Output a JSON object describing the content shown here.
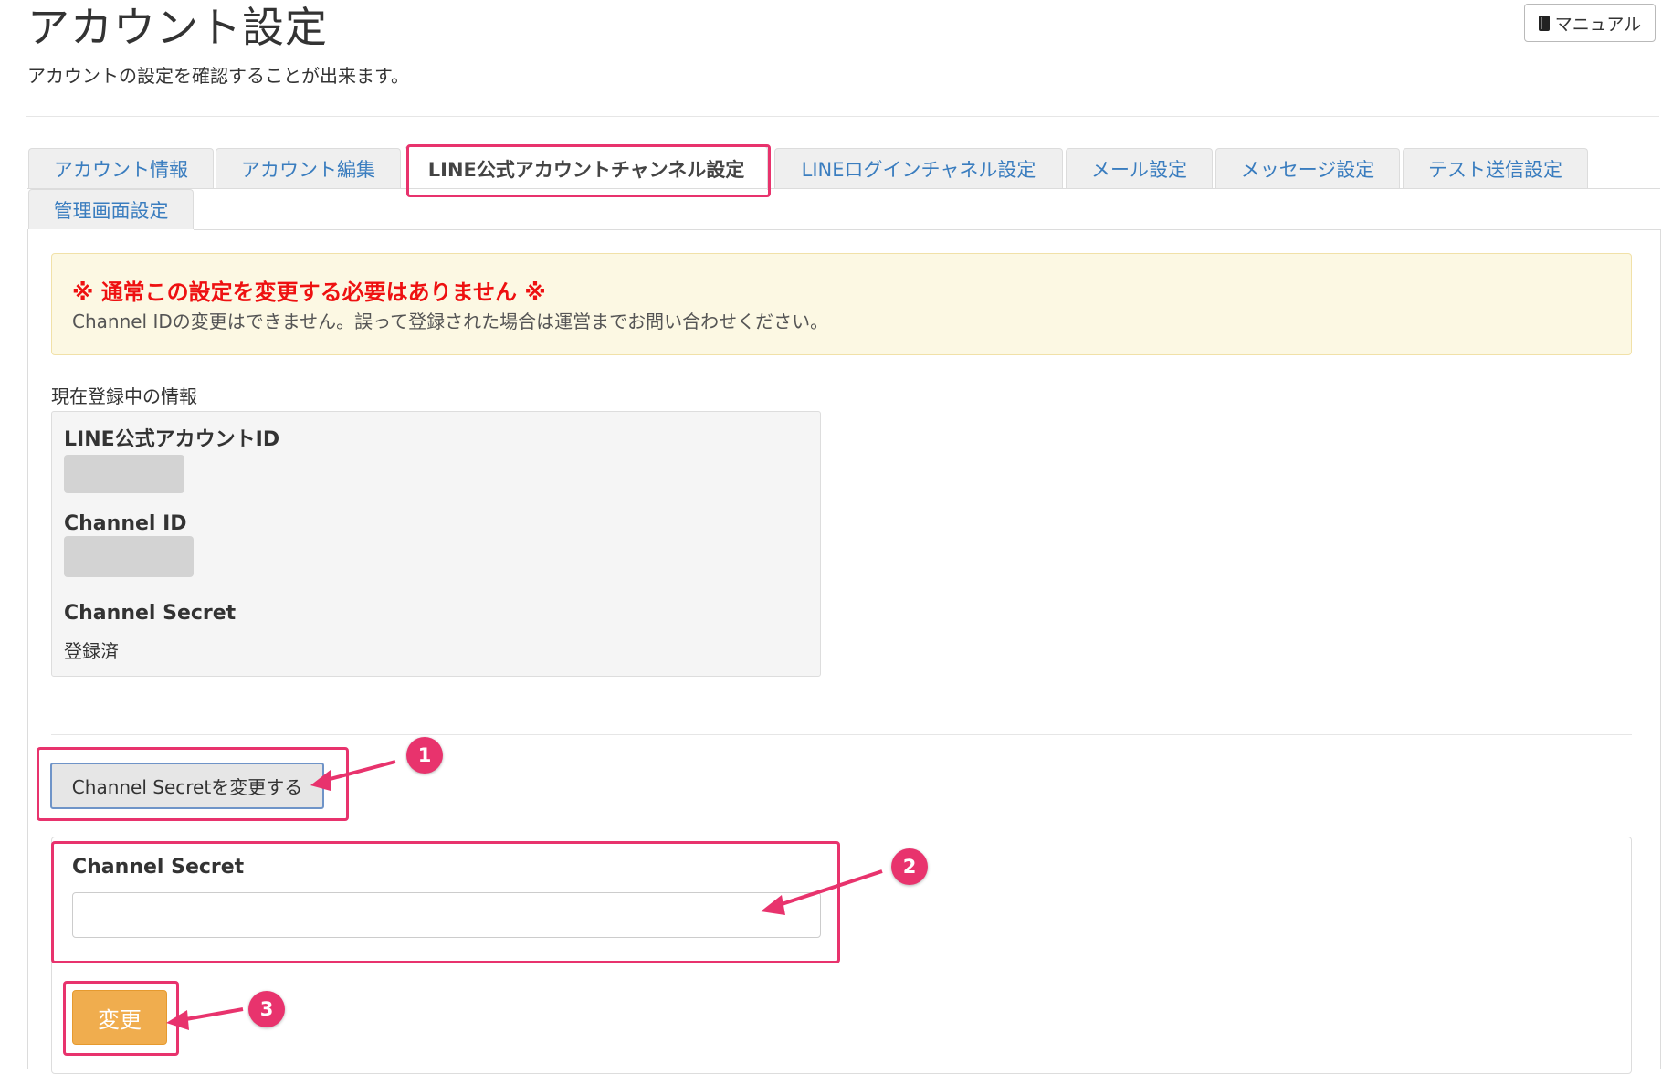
{
  "header": {
    "title": "アカウント設定",
    "subtitle": "アカウントの設定を確認することが出来ます。",
    "manual_button": {
      "label": "マニュアル",
      "icon": "book-icon"
    }
  },
  "tabs": [
    {
      "label": "アカウント情報",
      "active": false
    },
    {
      "label": "アカウント編集",
      "active": false
    },
    {
      "label": "LINE公式アカウントチャンネル設定",
      "active": true
    },
    {
      "label": "LINEログインチャネル設定",
      "active": false
    },
    {
      "label": "メール設定",
      "active": false
    },
    {
      "label": "メッセージ設定",
      "active": false
    },
    {
      "label": "テスト送信設定",
      "active": false
    },
    {
      "label": "管理画面設定",
      "active": false
    }
  ],
  "alert": {
    "title": "※ 通常この設定を変更する必要はありません ※",
    "body": "Channel IDの変更はできません。誤って登録された場合は運営までお問い合わせください。"
  },
  "current_info": {
    "section_label": "現在登録中の情報",
    "fields": [
      {
        "label": "LINE公式アカウントID",
        "value": ""
      },
      {
        "label": "Channel ID",
        "value": ""
      },
      {
        "label": "Channel Secret",
        "value": "登録済"
      }
    ]
  },
  "change_secret_button": {
    "label": "Channel Secretを変更する"
  },
  "form": {
    "label": "Channel Secret",
    "value": "",
    "placeholder": "",
    "submit_label": "変更"
  },
  "annotations": {
    "steps": [
      "1",
      "2",
      "3"
    ],
    "color": "#e8336d"
  },
  "colors": {
    "link_tab": "#3a7dbf",
    "alert_title": "#ee1111",
    "alert_bg": "#fcf8e3",
    "submit_bg": "#f0ad4e"
  }
}
